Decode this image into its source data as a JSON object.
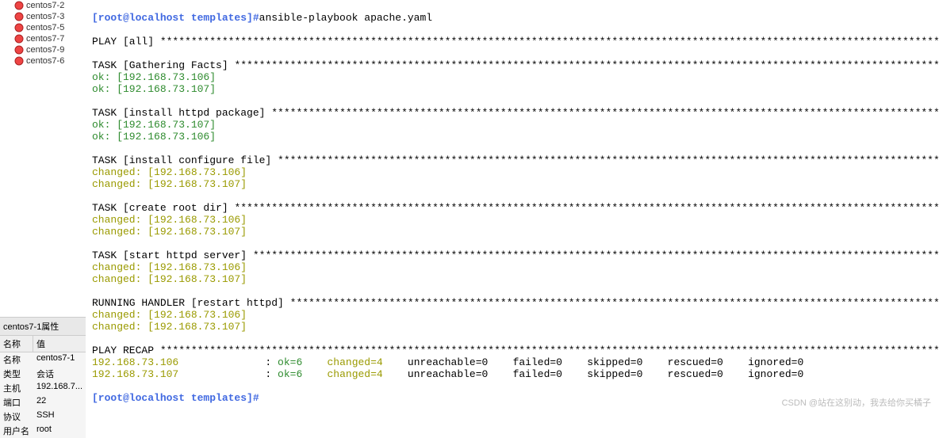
{
  "sidebar": {
    "sessions": [
      "centos7-2",
      "centos7-3",
      "centos7-5",
      "centos7-7",
      "centos7-9",
      "centos7-6"
    ]
  },
  "props": {
    "title": "centos7-1属性",
    "hdr_name": "名称",
    "hdr_value": "值",
    "rows": [
      {
        "k": "名称",
        "v": "centos7-1"
      },
      {
        "k": "类型",
        "v": "会话"
      },
      {
        "k": "主机",
        "v": "192.168.7..."
      },
      {
        "k": "端口",
        "v": "22"
      },
      {
        "k": "协议",
        "v": "SSH"
      },
      {
        "k": "用户名",
        "v": "root"
      }
    ]
  },
  "term": {
    "prompt": "[root@localhost templates]#",
    "cmd": "ansible-playbook apache.yaml",
    "play_all": "PLAY [all] ",
    "task_gather": "TASK [Gathering Facts] ",
    "ok_106": "ok: [192.168.73.106]",
    "ok_107": "ok: [192.168.73.107]",
    "task_install_pkg": "TASK [install httpd package] ",
    "task_install_cfg": "TASK [install configure file] ",
    "changed_106": "changed: [192.168.73.106]",
    "changed_107": "changed: [192.168.73.107]",
    "task_create_root": "TASK [create root dir] ",
    "task_start_httpd": "TASK [start httpd server] ",
    "running_handler": "RUNNING HANDLER [restart httpd] ",
    "play_recap": "PLAY RECAP ",
    "stars_long": "****************************************************************************************************************************************",
    "stars_gather": "*************************************************************************************************************************************",
    "stars_install_pkg": "*******************************************************************************************************************************",
    "stars_install_cfg": "******************************************************************************************************************************",
    "stars_create_root": "***********************************************************************************************************************************",
    "stars_start_httpd": "********************************************************************************************************************************",
    "stars_handler": "*************************************************************************************************************************",
    "stars_recap": "**********************************************************************************************************************************************",
    "recap": [
      {
        "host": "192.168.73.106",
        "ok": "ok=6",
        "changed": "changed=4",
        "unreach": "unreachable=0",
        "failed": "failed=0",
        "skipped": "skipped=0",
        "rescued": "rescued=0",
        "ignored": "ignored=0"
      },
      {
        "host": "192.168.73.107",
        "ok": "ok=6",
        "changed": "changed=4",
        "unreach": "unreachable=0",
        "failed": "failed=0",
        "skipped": "skipped=0",
        "rescued": "rescued=0",
        "ignored": "ignored=0"
      }
    ]
  },
  "watermark": "CSDN @站在这别动，我去给你买橘子"
}
